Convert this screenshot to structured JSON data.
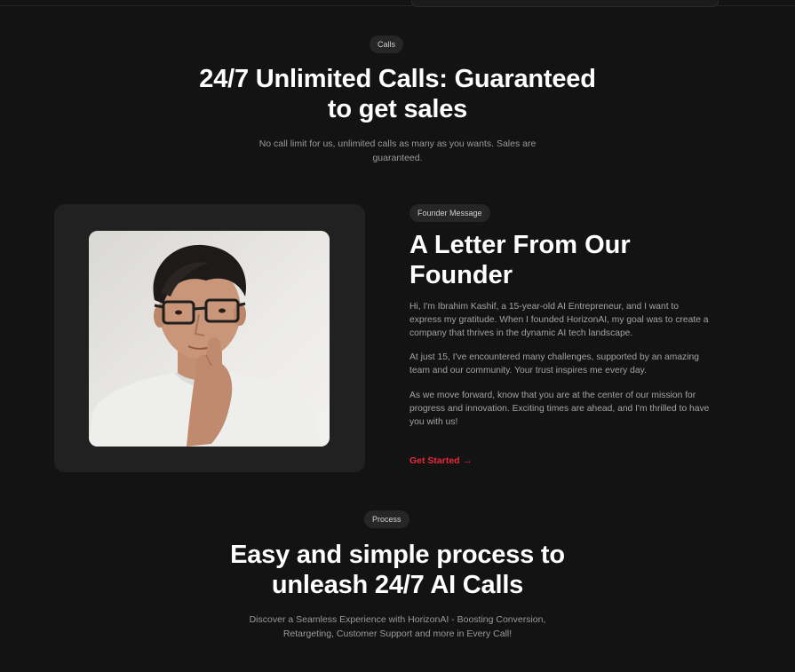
{
  "calls_section": {
    "badge": "Calls",
    "title_line1": "24/7 Unlimited Calls: Guaranteed",
    "title_line2": "to get sales",
    "subtitle_line1": "No call limit for us, unlimited calls as many as you wants. Sales are",
    "subtitle_line2": "guaranteed."
  },
  "founder_section": {
    "badge": "Founder Message",
    "title_line1": "A Letter From Our",
    "title_line2": "Founder",
    "paragraph1": [
      "Hi, I'm Ibrahim Kashif, a 15-year-old AI Entrepreneur, and I want to",
      "express my gratitude. When I founded HorizonAI, my goal was to create a",
      "company that thrives in the dynamic AI tech landscape."
    ],
    "paragraph2": [
      "At just 15, I've encountered many challenges, supported by an amazing",
      "team and our community. Your trust inspires me every day."
    ],
    "paragraph3": [
      "As we move forward, know that you are at the center of our mission for",
      "progress and innovation. Exciting times are ahead, and I'm thrilled to have",
      "you with us!"
    ],
    "cta_label": "Get Started",
    "cta_arrow": "→"
  },
  "process_section": {
    "badge": "Process",
    "title_line1": "Easy and simple process to",
    "title_line2": "unleash 24/7 AI Calls",
    "subtitle_line1": "Discover a Seamless Experience with HorizonAI - Boosting Conversion,",
    "subtitle_line2": "Retargeting, Customer Support and more in Every Call!"
  },
  "colors": {
    "background": "#131313",
    "card": "#212121",
    "badge": "#262626",
    "accent": "#e8283c"
  }
}
